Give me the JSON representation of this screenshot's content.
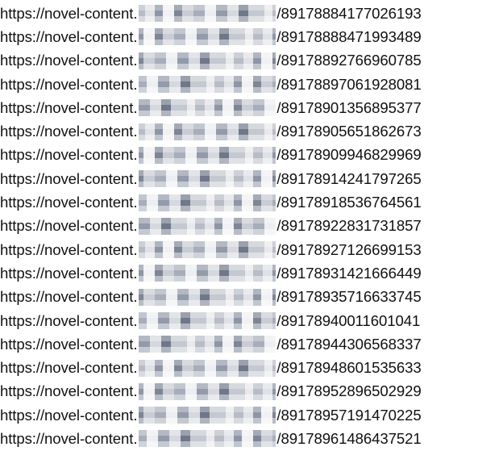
{
  "url_prefix": "https://novel-content.",
  "rows": [
    {
      "suffix": "/89178884177026193"
    },
    {
      "suffix": "/89178888471993489"
    },
    {
      "suffix": "/89178892766960785"
    },
    {
      "suffix": "/89178897061928081"
    },
    {
      "suffix": "/89178901356895377"
    },
    {
      "suffix": "/89178905651862673"
    },
    {
      "suffix": "/89178909946829969"
    },
    {
      "suffix": "/89178914241797265"
    },
    {
      "suffix": "/89178918536764561"
    },
    {
      "suffix": "/89178922831731857"
    },
    {
      "suffix": "/89178927126699153"
    },
    {
      "suffix": "/89178931421666449"
    },
    {
      "suffix": "/89178935716633745"
    },
    {
      "suffix": "/89178940011601041"
    },
    {
      "suffix": "/89178944306568337"
    },
    {
      "suffix": "/89178948601535633"
    },
    {
      "suffix": "/89178952896502929"
    },
    {
      "suffix": "/89178957191470225"
    },
    {
      "suffix": "/89178961486437521"
    }
  ],
  "redaction_color": "#9aa0ad"
}
